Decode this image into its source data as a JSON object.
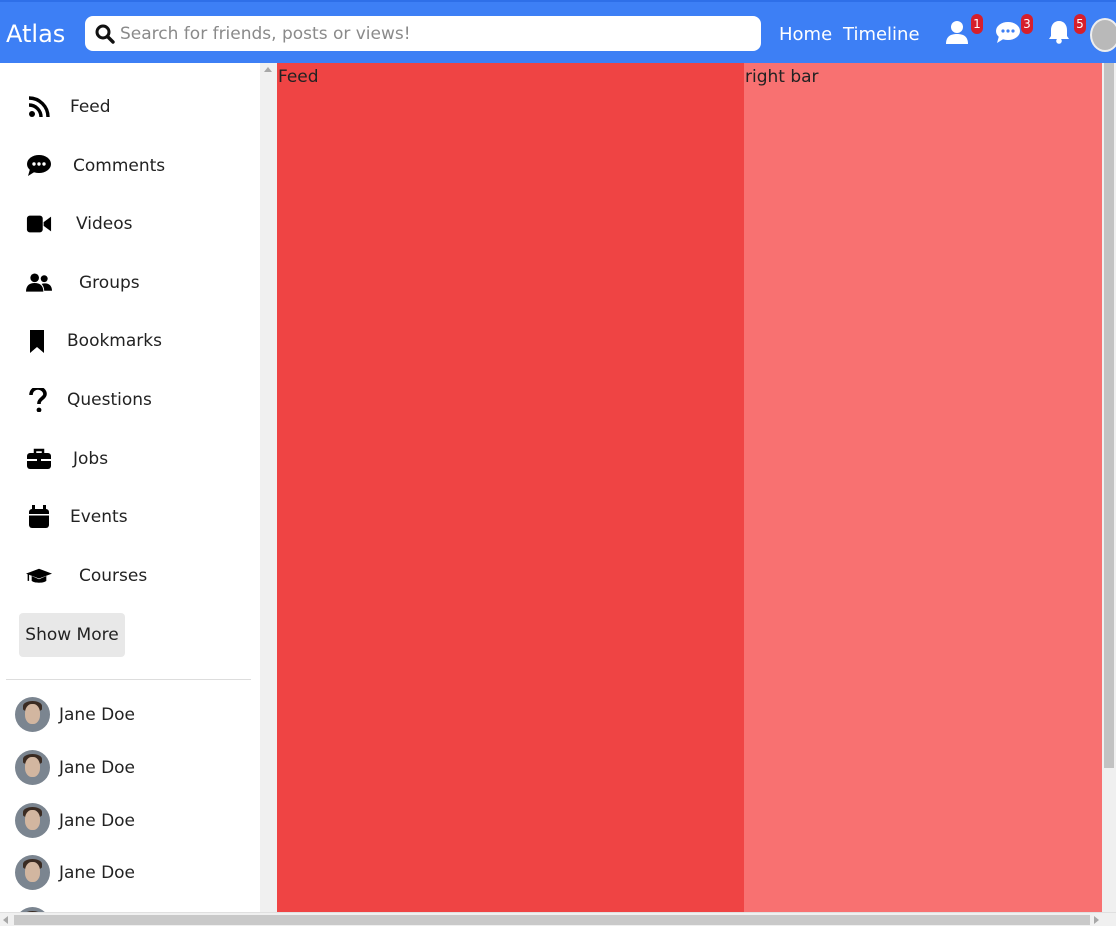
{
  "header": {
    "logo": "Atlas",
    "search_placeholder": "Search for friends, posts or views!",
    "links": [
      "Home",
      "Timeline"
    ],
    "badges": {
      "friends": "1",
      "messages": "3",
      "notifications": "5"
    },
    "accent": "#3d7ff5"
  },
  "sidebar": {
    "items": [
      {
        "label": "Feed",
        "icon": "rss-icon"
      },
      {
        "label": "Comments",
        "icon": "comment-icon"
      },
      {
        "label": "Videos",
        "icon": "video-camera-icon"
      },
      {
        "label": "Groups",
        "icon": "users-icon"
      },
      {
        "label": "Bookmarks",
        "icon": "bookmark-icon"
      },
      {
        "label": "Questions",
        "icon": "question-icon"
      },
      {
        "label": "Jobs",
        "icon": "briefcase-icon"
      },
      {
        "label": "Events",
        "icon": "calendar-icon"
      },
      {
        "label": "Courses",
        "icon": "graduation-cap-icon"
      }
    ],
    "show_more": "Show More",
    "friends": [
      "Jane Doe",
      "Jane Doe",
      "Jane Doe",
      "Jane Doe"
    ]
  },
  "main": {
    "feed_label": "Feed",
    "rightbar_label": "right bar",
    "feed_color": "#ef4444",
    "rightbar_color": "#f87171"
  }
}
